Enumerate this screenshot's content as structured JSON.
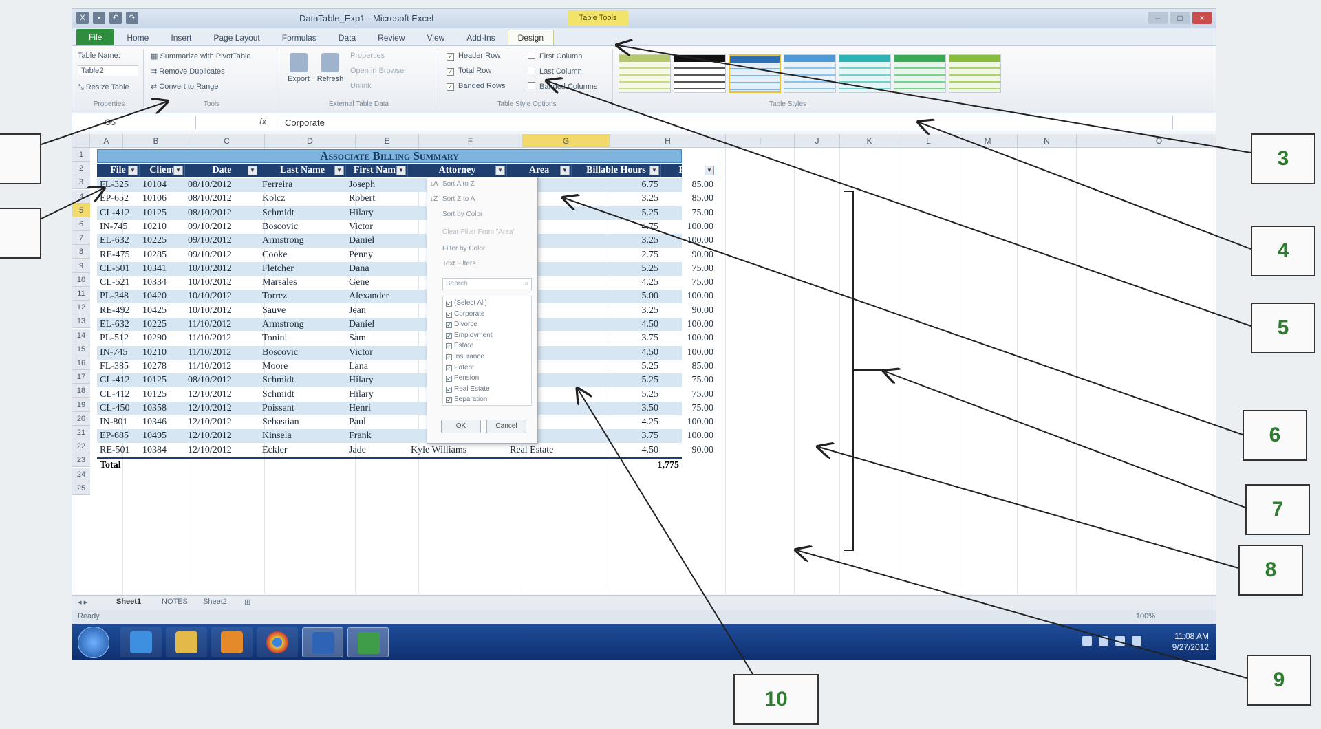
{
  "window": {
    "title": "DataTable_Exp1 - Microsoft Excel",
    "context_tab_title": "Table Tools"
  },
  "tabs": [
    "File",
    "Home",
    "Insert",
    "Page Layout",
    "Formulas",
    "Data",
    "Review",
    "View",
    "Add-Ins",
    "Design"
  ],
  "ribbon": {
    "properties": {
      "table_name_label": "Table Name:",
      "table_name_value": "Table2",
      "resize": "Resize Table",
      "group": "Properties"
    },
    "tools": {
      "summarize": "Summarize with PivotTable",
      "remove_dup": "Remove Duplicates",
      "convert": "Convert to Range",
      "group": "Tools"
    },
    "external": {
      "export": "Export",
      "refresh": "Refresh",
      "properties": "Properties",
      "open_browser": "Open in Browser",
      "unlink": "Unlink",
      "group": "External Table Data"
    },
    "style_options": {
      "header_row": "Header Row",
      "total_row": "Total Row",
      "banded_rows": "Banded Rows",
      "first_column": "First Column",
      "last_column": "Last Column",
      "banded_columns": "Banded Columns",
      "group": "Table Style Options"
    },
    "table_styles": {
      "group": "Table Styles"
    }
  },
  "formula_bar": {
    "name_box": "G5",
    "fx": "fx",
    "value": "Corporate"
  },
  "columns": [
    "A",
    "B",
    "C",
    "D",
    "E",
    "F",
    "G",
    "H",
    "I",
    "J",
    "K",
    "L",
    "M",
    "N",
    "O"
  ],
  "table": {
    "title": "Associate Billing Summary",
    "headers": [
      "File",
      "Client",
      "Date",
      "Last Name",
      "First Name",
      "Attorney",
      "Area",
      "Billable Hours",
      "Rate"
    ],
    "rows": [
      [
        "FL-325",
        "10104",
        "08/10/2012",
        "Ferreira",
        "Joseph",
        "",
        "",
        "6.75",
        "85.00"
      ],
      [
        "EP-652",
        "10106",
        "08/10/2012",
        "Kolcz",
        "Robert",
        "",
        "",
        "3.25",
        "85.00"
      ],
      [
        "CL-412",
        "10125",
        "08/10/2012",
        "Schmidt",
        "Hilary",
        "",
        "",
        "5.25",
        "75.00"
      ],
      [
        "IN-745",
        "10210",
        "09/10/2012",
        "Boscovic",
        "Victor",
        "",
        "",
        "4.75",
        "100.00"
      ],
      [
        "EL-632",
        "10225",
        "09/10/2012",
        "Armstrong",
        "Daniel",
        "",
        "",
        "3.25",
        "100.00"
      ],
      [
        "RE-475",
        "10285",
        "09/10/2012",
        "Cooke",
        "Penny",
        "",
        "",
        "2.75",
        "90.00"
      ],
      [
        "CL-501",
        "10341",
        "10/10/2012",
        "Fletcher",
        "Dana",
        "",
        "",
        "5.25",
        "75.00"
      ],
      [
        "CL-521",
        "10334",
        "10/10/2012",
        "Marsales",
        "Gene",
        "",
        "",
        "4.25",
        "75.00"
      ],
      [
        "PL-348",
        "10420",
        "10/10/2012",
        "Torrez",
        "Alexander",
        "",
        "",
        "5.00",
        "100.00"
      ],
      [
        "RE-492",
        "10425",
        "10/10/2012",
        "Sauve",
        "Jean",
        "",
        "",
        "3.25",
        "90.00"
      ],
      [
        "EL-632",
        "10225",
        "11/10/2012",
        "Armstrong",
        "Daniel",
        "",
        "",
        "4.50",
        "100.00"
      ],
      [
        "PL-512",
        "10290",
        "11/10/2012",
        "Tonini",
        "Sam",
        "",
        "",
        "3.75",
        "100.00"
      ],
      [
        "IN-745",
        "10210",
        "11/10/2012",
        "Boscovic",
        "Victor",
        "",
        "",
        "4.50",
        "100.00"
      ],
      [
        "FL-385",
        "10278",
        "11/10/2012",
        "Moore",
        "Lana",
        "",
        "",
        "5.25",
        "85.00"
      ],
      [
        "CL-412",
        "10125",
        "08/10/2012",
        "Schmidt",
        "Hilary",
        "",
        "",
        "5.25",
        "75.00"
      ],
      [
        "CL-412",
        "10125",
        "12/10/2012",
        "Schmidt",
        "Hilary",
        "",
        "",
        "5.25",
        "75.00"
      ],
      [
        "CL-450",
        "10358",
        "12/10/2012",
        "Poissant",
        "Henri",
        "",
        "",
        "3.50",
        "75.00"
      ],
      [
        "IN-801",
        "10346",
        "12/10/2012",
        "Sebastian",
        "Paul",
        "",
        "",
        "4.25",
        "100.00"
      ],
      [
        "EP-685",
        "10495",
        "12/10/2012",
        "Kinsela",
        "Frank",
        "",
        "",
        "3.75",
        "100.00"
      ],
      [
        "RE-501",
        "10384",
        "12/10/2012",
        "Eckler",
        "Jade",
        "Kyle Williams",
        "Real Estate",
        "4.50",
        "90.00"
      ]
    ],
    "total_label": "Total",
    "total_value": "1,775"
  },
  "filter_menu": {
    "sort_az": "Sort A to Z",
    "sort_za": "Sort Z to A",
    "sort_color": "Sort by Color",
    "clear": "Clear Filter From \"Area\"",
    "filter_color": "Filter by Color",
    "text_filters": "Text Filters",
    "search": "Search",
    "options": [
      "(Select All)",
      "Corporate",
      "Divorce",
      "Employment",
      "Estate",
      "Insurance",
      "Patent",
      "Pension",
      "Real Estate",
      "Separation"
    ],
    "ok": "OK",
    "cancel": "Cancel"
  },
  "sheet_tabs": [
    "Sheet1",
    "NOTES",
    "Sheet2"
  ],
  "status": {
    "ready": "Ready",
    "zoom": "100%"
  },
  "clock": {
    "time": "11:08 AM",
    "date": "9/27/2012"
  },
  "callouts": [
    "3",
    "4",
    "5",
    "6",
    "7",
    "8",
    "9",
    "10"
  ]
}
